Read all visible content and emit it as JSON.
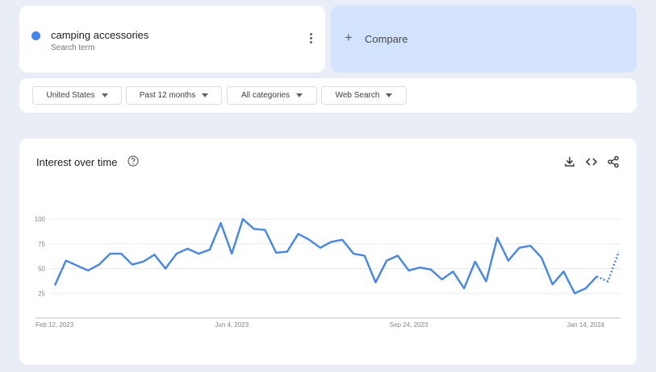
{
  "search_term": {
    "name": "camping accessories",
    "subtitle": "Search term",
    "color": "#4285f4"
  },
  "compare": {
    "label": "Compare",
    "icon": "plus-icon"
  },
  "filters": [
    {
      "label": "United States"
    },
    {
      "label": "Past 12 months"
    },
    {
      "label": "All categories"
    },
    {
      "label": "Web Search"
    }
  ],
  "card": {
    "title": "Interest over time",
    "icons": [
      "help-icon",
      "download-icon",
      "embed-icon",
      "share-icon"
    ]
  },
  "chart_data": {
    "type": "line",
    "title": "Interest over time",
    "xlabel": "",
    "ylabel": "",
    "ylim": [
      0,
      100
    ],
    "y_ticks": [
      25,
      50,
      75,
      100
    ],
    "x_tick_labels": [
      "Feb 12, 2023",
      "Jun 4, 2023",
      "Sep 24, 2023",
      "Jan 14, 2024"
    ],
    "x_tick_weeks": [
      0,
      16,
      32,
      48
    ],
    "grid": true,
    "series": [
      {
        "name": "camping accessories",
        "color": "#4285f4",
        "values": [
          33,
          58,
          53,
          48,
          54,
          65,
          65,
          54,
          57,
          64,
          50,
          65,
          70,
          65,
          69,
          96,
          65,
          100,
          90,
          89,
          66,
          67,
          85,
          79,
          71,
          77,
          79,
          65,
          63,
          36,
          58,
          63,
          48,
          51,
          49,
          39,
          47,
          30,
          57,
          37,
          81,
          58,
          71,
          73,
          61,
          34,
          47,
          25,
          30,
          42,
          37,
          67
        ],
        "partial_last_points": 2
      }
    ]
  }
}
